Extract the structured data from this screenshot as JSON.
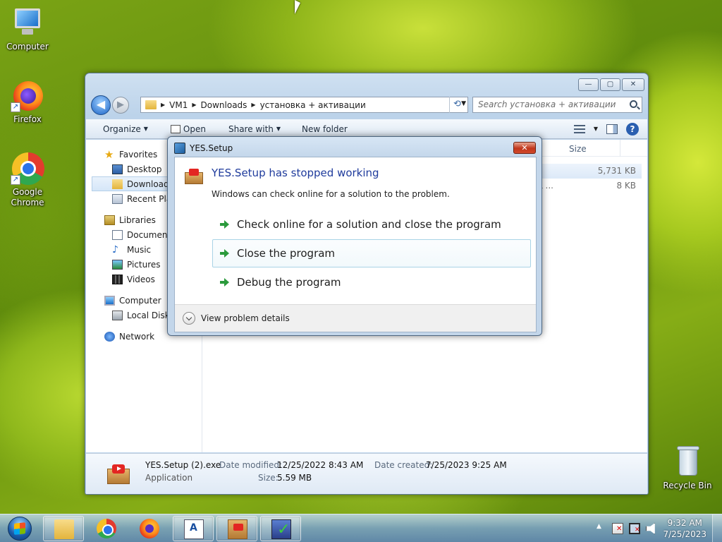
{
  "desktop": {
    "icons": [
      {
        "label": "Computer"
      },
      {
        "label": "Firefox"
      },
      {
        "label": "Google Chrome"
      },
      {
        "label": "Recycle Bin"
      }
    ]
  },
  "explorer": {
    "caption_buttons": {
      "minimize": "—",
      "maximize": "▢",
      "close": "✕"
    },
    "nav": {
      "back": "◀",
      "forward": "▶"
    },
    "breadcrumbs": [
      "VM1",
      "Downloads",
      "установка + активации"
    ],
    "search_placeholder": "Search установка + активации",
    "toolbar": {
      "organize": "Organize",
      "open": "Open",
      "share_with": "Share with",
      "new_folder": "New folder"
    },
    "nav_pane": {
      "favorites": "Favorites",
      "desktop": "Desktop",
      "downloads": "Downloads",
      "recent": "Recent Plac",
      "libraries": "Libraries",
      "documents": "Documents",
      "music": "Music",
      "pictures": "Pictures",
      "videos": "Videos",
      "computer": "Computer",
      "local_disk": "Local Disk (",
      "network": "Network"
    },
    "columns": {
      "size": "Size"
    },
    "files": [
      {
        "type": "",
        "size": "5,731 KB"
      },
      {
        "type": "L ...",
        "size": "8 KB"
      }
    ],
    "details": {
      "name": "YES.Setup (2).exe",
      "kind": "Application",
      "modified_label": "Date modified:",
      "modified_value": "12/25/2022 8:43 AM",
      "size_label": "Size:",
      "size_value": "5.59 MB",
      "created_label": "Date created:",
      "created_value": "7/25/2023 9:25 AM"
    }
  },
  "dialog": {
    "title": "YES.Setup",
    "close": "✕",
    "heading": "YES.Setup has stopped working",
    "message": "Windows can check online for a solution to the problem.",
    "options": [
      "Check online for a solution and close the program",
      "Close the program",
      "Debug the program"
    ],
    "details_toggle": "View problem details"
  },
  "taskbar": {
    "clock_time": "9:32 AM",
    "clock_date": "7/25/2023",
    "tray_up": "▲"
  }
}
